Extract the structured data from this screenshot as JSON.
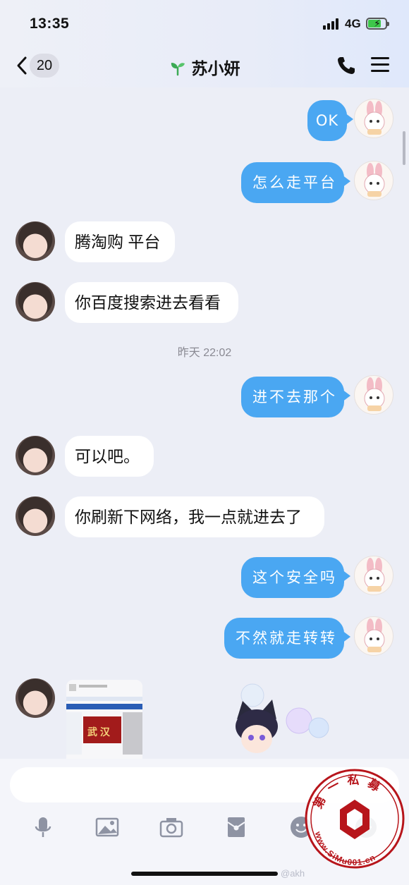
{
  "status_bar": {
    "time": "13:35",
    "network": "4G"
  },
  "header": {
    "back_count": "20",
    "contact_name": "苏小妍"
  },
  "messages": [
    {
      "side": "out",
      "text": "OK"
    },
    {
      "side": "out",
      "text": "怎么走平台"
    },
    {
      "side": "in",
      "text": "腾淘购 平台"
    },
    {
      "side": "in",
      "text": "你百度搜索进去看看"
    },
    {
      "side": "time",
      "text": "昨天 22:02"
    },
    {
      "side": "out",
      "text": "进不去那个"
    },
    {
      "side": "in",
      "text": "可以吧。"
    },
    {
      "side": "in",
      "text": "你刷新下网络，我一点就进去了"
    },
    {
      "side": "out",
      "text": "这个安全吗"
    },
    {
      "side": "out",
      "text": "不然就走转转"
    }
  ],
  "image_message": {
    "banner_text": "武 汉"
  },
  "input": {
    "placeholder": ""
  },
  "toolbar": [
    "microphone-icon",
    "image-icon",
    "camera-icon",
    "red-packet-icon",
    "emoji-icon",
    "more-icon"
  ],
  "watermark": {
    "seal_text": "第一私募",
    "url_text": "www.SiMu001.cn",
    "source_text": "@akh"
  },
  "colors": {
    "outgoing_bubble": "#4aa7f2",
    "incoming_bubble": "#ffffff",
    "background": "#eceef6"
  }
}
